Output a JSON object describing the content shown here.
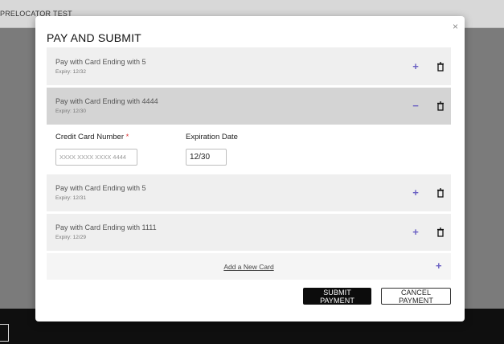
{
  "background": {
    "nav_items": [
      "PRELOCATOR",
      "TEST"
    ]
  },
  "modal": {
    "title": "PAY AND SUBMIT",
    "close_glyph": "×",
    "cards": [
      {
        "title": "Pay with Card Ending with 5",
        "expiry": "Expiry: 12/32",
        "toggle": "+",
        "expanded": false
      },
      {
        "title": "Pay with Card Ending with 4444",
        "expiry": "Expiry: 12/30",
        "toggle": "−",
        "expanded": true
      },
      {
        "title": "Pay with Card Ending with 5",
        "expiry": "Expiry: 12/31",
        "toggle": "+",
        "expanded": false
      },
      {
        "title": "Pay with Card Ending with 1111",
        "expiry": "Expiry: 12/29",
        "toggle": "+",
        "expanded": false
      }
    ],
    "form": {
      "card_number_label": "Credit Card Number",
      "required_mark": "*",
      "card_number_placeholder": "XXXX XXXX XXXX 4444",
      "card_number_value": "",
      "expiration_label": "Expiration Date",
      "expiration_value": "12/30"
    },
    "add_card": {
      "label": "Add a New Card",
      "plus": "+"
    },
    "buttons": {
      "submit": "SUBMIT PAYMENT",
      "cancel": "CANCEL PAYMENT"
    }
  },
  "colors": {
    "accent": "#6b61c3",
    "overlay": "#7b7b7b",
    "active_row": "#d4d4d4",
    "row": "#efefef"
  },
  "icons": [
    "close-icon",
    "plus-icon",
    "minus-icon",
    "trash-icon"
  ]
}
